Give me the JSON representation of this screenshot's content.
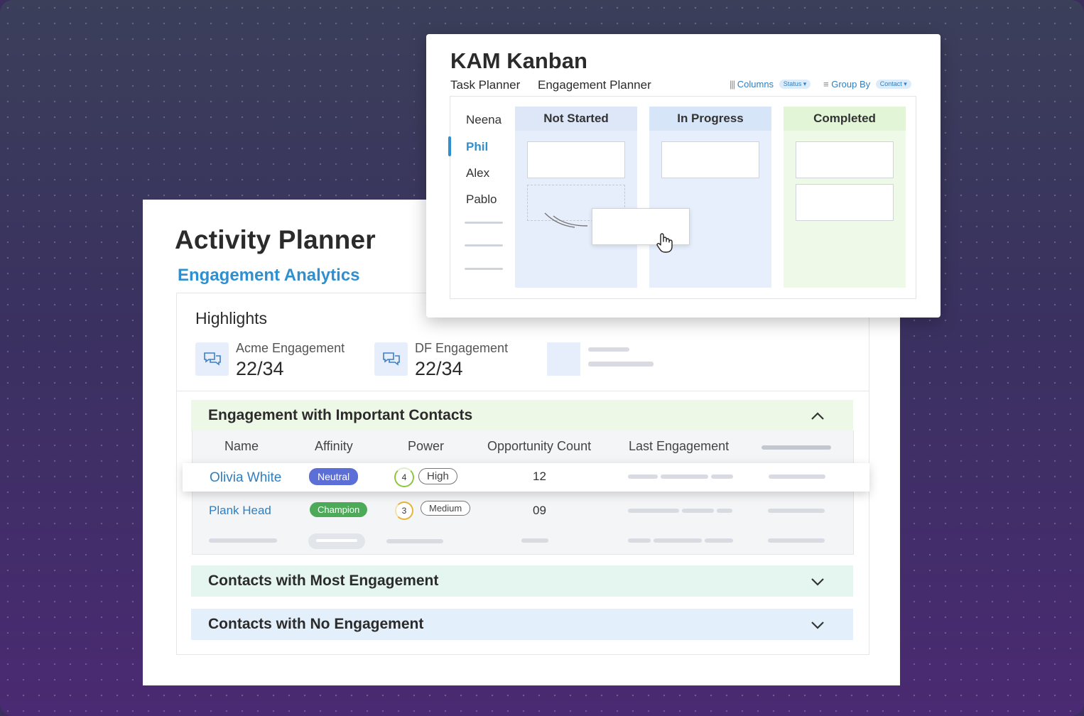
{
  "activity_planner": {
    "title": "Activity Planner",
    "subtitle": "Engagement Analytics",
    "highlights": {
      "title": "Highlights",
      "items": [
        {
          "label": "Acme Engagement",
          "value": "22/34",
          "icon": "chat-bubbles-icon"
        },
        {
          "label": "DF Engagement",
          "value": "22/34",
          "icon": "chat-bubbles-icon"
        }
      ]
    },
    "sections": {
      "important": {
        "title": "Engagement with Important Contacts",
        "state": "expanded"
      },
      "most": {
        "title": "Contacts with Most Engagement",
        "state": "collapsed"
      },
      "none": {
        "title": "Contacts with No Engagement",
        "state": "collapsed"
      }
    },
    "table": {
      "columns": [
        "Name",
        "Affinity",
        "Power",
        "Opportunity Count",
        "Last Engagement"
      ],
      "rows": [
        {
          "name": "Olivia White",
          "affinity": "Neutral",
          "power_score": "4",
          "power": "High",
          "opportunity_count": "12"
        },
        {
          "name": "Plank Head",
          "affinity": "Champion",
          "power_score": "3",
          "power": "Medium",
          "opportunity_count": "09"
        }
      ]
    },
    "colors": {
      "neutral_badge": "#5b6fd6",
      "champion_badge": "#4caa58",
      "section_important": "#eef8e6",
      "section_most": "#e4f6ef",
      "section_none": "#e3f0fb",
      "accent_blue": "#2f8fcf"
    }
  },
  "kanban": {
    "title": "KAM Kanban",
    "tabs": [
      "Task Planner",
      "Engagement Planner"
    ],
    "controls": {
      "columns_label": "Columns",
      "columns_value": "Status",
      "group_label": "Group By",
      "group_value": "Contact"
    },
    "people": [
      "Neena",
      "Phil",
      "Alex",
      "Pablo"
    ],
    "active_person": "Phil",
    "columns": [
      {
        "title": "Not Started",
        "color": "#e6eefb",
        "header_color": "#dde7f7"
      },
      {
        "title": "In Progress",
        "color": "#e6effb",
        "header_color": "#d6e6f8"
      },
      {
        "title": "Completed",
        "color": "#eef9e8",
        "header_color": "#e2f5d7"
      }
    ]
  }
}
